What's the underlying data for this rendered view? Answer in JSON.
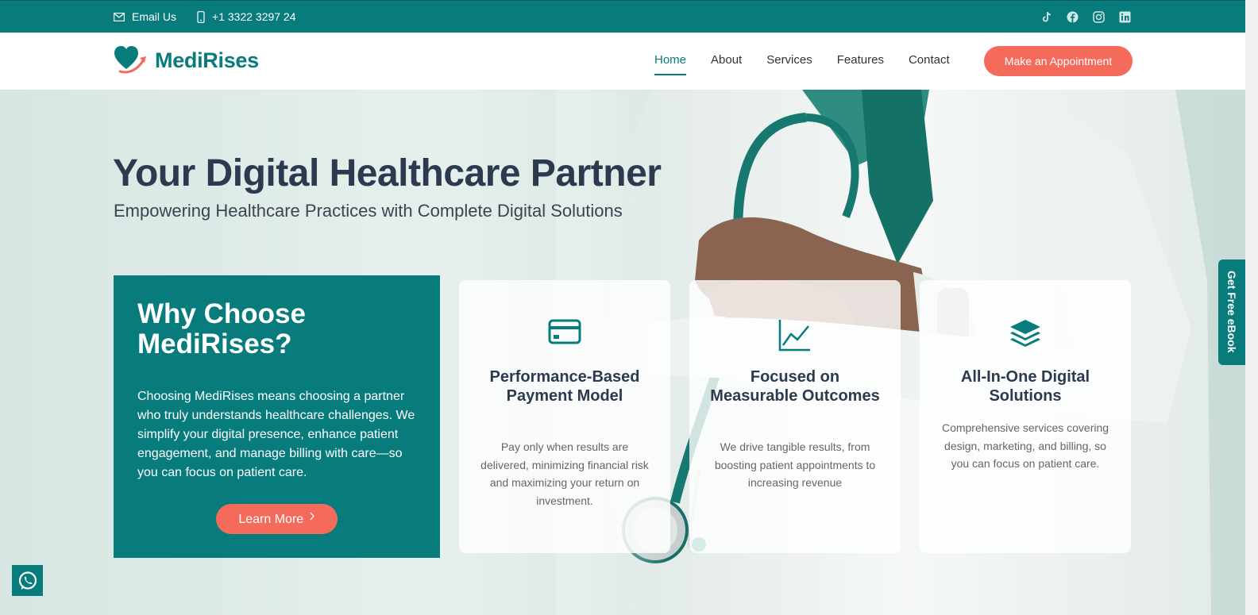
{
  "topbar": {
    "email_label": "Email Us",
    "phone_label": "+1 3322 3297 24",
    "social_icons": [
      "tiktok-icon",
      "facebook-icon",
      "instagram-icon",
      "linkedin-icon"
    ]
  },
  "header": {
    "brand": "MediRises",
    "nav": [
      "Home",
      "About",
      "Services",
      "Features",
      "Contact"
    ],
    "active_nav": "Home",
    "cta_label": "Make an Appointment"
  },
  "hero": {
    "title": "Your Digital Healthcare Partner",
    "subtitle": "Empowering Healthcare Practices with Complete Digital Solutions"
  },
  "why": {
    "title": "Why Choose MediRises?",
    "body": "Choosing MediRises means choosing a partner who truly understands healthcare challenges. We simplify your digital presence, enhance patient engagement, and manage billing with care—so you can focus on patient care.",
    "button_label": "Learn More"
  },
  "cards": [
    {
      "icon": "credit-card-icon",
      "title": "Performance-Based Payment Model",
      "text": "Pay only when results are delivered, minimizing financial risk and maximizing your return on investment."
    },
    {
      "icon": "line-chart-icon",
      "title": "Focused on Measurable Outcomes",
      "text": "We drive tangible results, from boosting patient appointments to increasing revenue"
    },
    {
      "icon": "layers-icon",
      "title": "All-In-One Digital Solutions",
      "text": "Comprehensive services covering design, marketing, and billing, so you can focus on patient care."
    }
  ],
  "ebook_label": "Get Free eBook",
  "colors": {
    "primary": "#087c7c",
    "accent": "#f46b5b",
    "heading": "#2b3a4e"
  }
}
